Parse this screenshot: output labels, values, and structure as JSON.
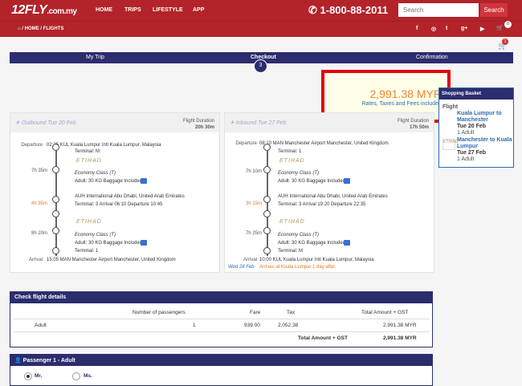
{
  "header": {
    "logo": "12FLY",
    "logo_suffix": ".com.my",
    "nav": [
      "HOME",
      "TRIPS",
      "LIFESTYLE",
      "APP"
    ],
    "phone": "1-800-88-2011",
    "search_placeholder": "Search",
    "search_button": "Search",
    "cart_count": "0"
  },
  "breadcrumb": [
    "HOME",
    "FLIGHTS"
  ],
  "social_icons": [
    "facebook-icon",
    "instagram-icon",
    "twitter-icon",
    "google-plus-icon",
    "youtube-icon",
    "cart-icon"
  ],
  "cart2_count": "1",
  "steps": {
    "items": [
      "My Trip",
      "Checkout",
      "Confirmation"
    ],
    "current_number": "3"
  },
  "price": {
    "amount": "2,991.38 MYR",
    "note": "Rates, Taxes and Fees included"
  },
  "outbound": {
    "header": "Outbound  Tue 20 Feb",
    "duration_label": "Flight Duration",
    "duration": "20h 30m",
    "departure_label": "Departure",
    "departure": "02:35 KUL Kuala Lumpur Intl Kuala Lumpur, Malaysia",
    "departure_terminal": "Terminal: M",
    "seg1_time": "7h 35m",
    "airline1": "ETIHAD",
    "class1": "Economy Class (T)",
    "bag1": "Adult: 30 KG Baggage Included",
    "layover": "4h 35m",
    "stop": "AUH International Abu Dhabi, United Arab Emirates",
    "stop_detail": "Terminal: 3  Arrival 06:10 Departure 10:45",
    "seg2_time": "8h 20m",
    "airline2": "ETIHAD",
    "class2": "Economy Class (T)",
    "bag2": "Adult: 30 KG Baggage Included",
    "bag2_terminal": "Terminal: 1",
    "arrival_label": "Arrival",
    "arrival": "15:05 MAN Manchester Airport Manchester, United Kingdom"
  },
  "inbound": {
    "header": "Inbound  Tue 27 Feb",
    "duration_label": "Flight Duration",
    "duration": "17h 50m",
    "departure_label": "Departure",
    "departure": "08:10 MAN Manchester Airport Manchester, United Kingdom",
    "departure_terminal": "Terminal: 1",
    "seg1_time": "7h 10m",
    "airline1": "ETIHAD",
    "class1": "Economy Class (T)",
    "bag1": "Adult: 30 KG Baggage Included",
    "layover": "3h 15m",
    "stop": "AUH International Abu Dhabi, United Arab Emirates",
    "stop_detail": "Terminal: 3  Arrival 19:20 Departure 22:35",
    "seg2_time": "7h 25m",
    "airline2": "ETIHAD",
    "class2": "Economy Class (T)",
    "bag2": "Adult: 30 KG Baggage Included",
    "bag2_terminal": "Terminal: M",
    "arrival_label": "Arrival",
    "arrival": "10:00 KUL Kuala Lumpur Intl Kuala Lumpur, Malaysia",
    "arrival_date": "Wed 28 Feb",
    "arrival_note": "Arrives at Kuala Lumpur 1 day after."
  },
  "basket": {
    "title": "Shopping Basket",
    "section": "Flight",
    "f1_route": "Kuala Lumpur to Manchester",
    "f1_date": "Tue 20 Feb",
    "f1_pax": "1 Adult",
    "f2_route": "Manchester to Kuala Lumpur",
    "f2_date": "Tue 27 Feb",
    "f2_pax": "1 Adult"
  },
  "details": {
    "title": "Check flight details",
    "columns": [
      "Number of passengers",
      "Fare",
      "Tax",
      "Total Amount + GST"
    ],
    "row": {
      "type": "Adult",
      "passengers": "1",
      "fare": "939.00",
      "tax": "2,052.38",
      "total": "2,991.38 MYR"
    },
    "total_label": "Total Amount + GST",
    "total_value": "2,991.38 MYR"
  },
  "passenger": {
    "title": "Passenger 1 - Adult",
    "options": [
      "Mr.",
      "Ms."
    ]
  },
  "colors": {
    "brand_red": "#b3232a",
    "navy": "#2b2d6e",
    "price_orange": "#f0862c",
    "highlight_red": "#e1050f"
  }
}
